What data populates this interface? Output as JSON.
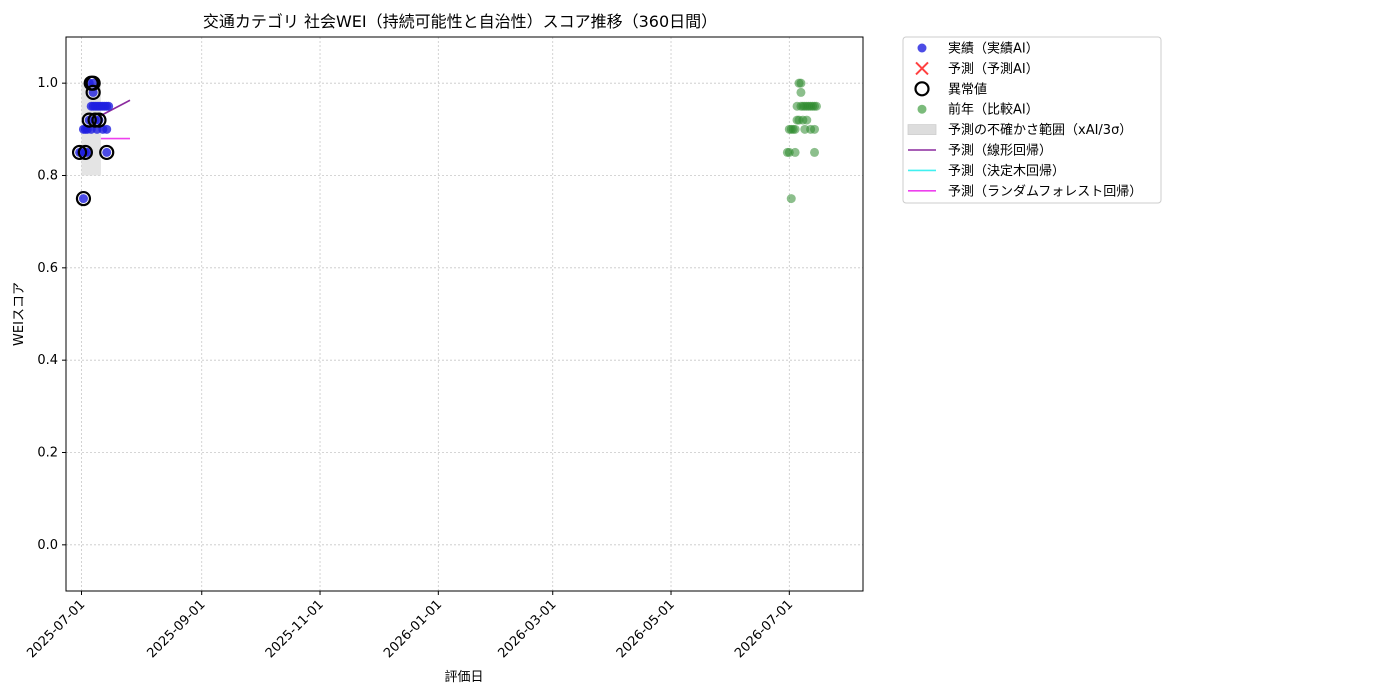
{
  "chart_data": {
    "type": "scatter",
    "title": "交通カテゴリ 社会WEI（持続可能性と自治性）スコア推移（360日間）",
    "xlabel": "評価日",
    "ylabel": "WEIスコア",
    "xlim": [
      "2025-06-23",
      "2026-08-08"
    ],
    "ylim": [
      -0.1,
      1.1
    ],
    "yticks": [
      0.0,
      0.2,
      0.4,
      0.6,
      0.8,
      1.0
    ],
    "ytick_labels": [
      "0.0",
      "0.2",
      "0.4",
      "0.6",
      "0.8",
      "1.0"
    ],
    "xticks": [
      "2025-07-01",
      "2025-09-01",
      "2025-11-01",
      "2026-01-01",
      "2026-03-01",
      "2026-05-01",
      "2026-07-01"
    ],
    "grid": true,
    "legend_position": "outside-right-top",
    "legend": [
      {
        "label": "実績（実績AI）",
        "kind": "dot",
        "color": "#1f1fe0"
      },
      {
        "label": "予測（予測AI）",
        "kind": "x",
        "color": "#ff4040"
      },
      {
        "label": "異常値",
        "kind": "ring",
        "color": "#000000"
      },
      {
        "label": "前年（比較AI）",
        "kind": "dot",
        "color": "#5aaa5a"
      },
      {
        "label": "予測の不確かさ範囲（xAI/3σ）",
        "kind": "band",
        "color": "#dddddd"
      },
      {
        "label": "予測（線形回帰）",
        "kind": "line",
        "color": "#8b2a9e"
      },
      {
        "label": "予測（決定木回帰）",
        "kind": "line",
        "color": "#40f0f0"
      },
      {
        "label": "予測（ランダムフォレスト回帰）",
        "kind": "line",
        "color": "#ee40ee"
      }
    ],
    "series": [
      {
        "name": "実績（実績AI）",
        "kind": "scatter",
        "color": "#1f1fe0",
        "points": [
          {
            "x": "2025-06-30",
            "y": 0.85
          },
          {
            "x": "2025-07-01",
            "y": 0.85
          },
          {
            "x": "2025-07-02",
            "y": 0.9
          },
          {
            "x": "2025-07-02",
            "y": 0.75
          },
          {
            "x": "2025-07-03",
            "y": 0.85
          },
          {
            "x": "2025-07-03",
            "y": 0.9
          },
          {
            "x": "2025-07-04",
            "y": 0.85
          },
          {
            "x": "2025-07-04",
            "y": 0.9
          },
          {
            "x": "2025-07-05",
            "y": 0.92
          },
          {
            "x": "2025-07-05",
            "y": 1.0
          },
          {
            "x": "2025-07-06",
            "y": 0.95
          },
          {
            "x": "2025-07-06",
            "y": 0.9
          },
          {
            "x": "2025-07-07",
            "y": 0.98
          },
          {
            "x": "2025-07-07",
            "y": 1.0
          },
          {
            "x": "2025-07-07",
            "y": 0.95
          },
          {
            "x": "2025-07-08",
            "y": 0.92
          },
          {
            "x": "2025-07-08",
            "y": 0.95
          },
          {
            "x": "2025-07-09",
            "y": 0.9
          },
          {
            "x": "2025-07-09",
            "y": 0.95
          },
          {
            "x": "2025-07-10",
            "y": 0.92
          },
          {
            "x": "2025-07-10",
            "y": 0.95
          },
          {
            "x": "2025-07-11",
            "y": 0.95
          },
          {
            "x": "2025-07-12",
            "y": 0.9
          },
          {
            "x": "2025-07-12",
            "y": 0.95
          },
          {
            "x": "2025-07-13",
            "y": 0.95
          },
          {
            "x": "2025-07-14",
            "y": 0.85
          },
          {
            "x": "2025-07-14",
            "y": 0.9
          },
          {
            "x": "2025-07-14",
            "y": 0.95
          },
          {
            "x": "2025-07-15",
            "y": 0.95
          }
        ]
      },
      {
        "name": "異常値",
        "kind": "rings",
        "color": "#000000",
        "points": [
          {
            "x": "2025-06-30",
            "y": 0.85
          },
          {
            "x": "2025-07-02",
            "y": 0.75
          },
          {
            "x": "2025-07-03",
            "y": 0.85
          },
          {
            "x": "2025-07-05",
            "y": 0.92
          },
          {
            "x": "2025-07-06",
            "y": 1.0
          },
          {
            "x": "2025-07-07",
            "y": 0.98
          },
          {
            "x": "2025-07-07",
            "y": 1.0
          },
          {
            "x": "2025-07-08",
            "y": 0.92
          },
          {
            "x": "2025-07-10",
            "y": 0.92
          },
          {
            "x": "2025-07-14",
            "y": 0.85
          }
        ]
      },
      {
        "name": "前年（比較AI）",
        "kind": "scatter",
        "color": "#2e8b2e",
        "points": [
          {
            "x": "2026-06-30",
            "y": 0.85
          },
          {
            "x": "2026-07-01",
            "y": 0.9
          },
          {
            "x": "2026-07-01",
            "y": 0.85
          },
          {
            "x": "2026-07-02",
            "y": 0.75
          },
          {
            "x": "2026-07-02",
            "y": 0.9
          },
          {
            "x": "2026-07-03",
            "y": 0.9
          },
          {
            "x": "2026-07-04",
            "y": 0.85
          },
          {
            "x": "2026-07-04",
            "y": 0.9
          },
          {
            "x": "2026-07-05",
            "y": 0.92
          },
          {
            "x": "2026-07-05",
            "y": 0.95
          },
          {
            "x": "2026-07-06",
            "y": 1.0
          },
          {
            "x": "2026-07-06",
            "y": 0.92
          },
          {
            "x": "2026-07-07",
            "y": 0.98
          },
          {
            "x": "2026-07-07",
            "y": 1.0
          },
          {
            "x": "2026-07-07",
            "y": 0.95
          },
          {
            "x": "2026-07-08",
            "y": 0.92
          },
          {
            "x": "2026-07-08",
            "y": 0.95
          },
          {
            "x": "2026-07-09",
            "y": 0.9
          },
          {
            "x": "2026-07-09",
            "y": 0.95
          },
          {
            "x": "2026-07-10",
            "y": 0.92
          },
          {
            "x": "2026-07-10",
            "y": 0.95
          },
          {
            "x": "2026-07-11",
            "y": 0.95
          },
          {
            "x": "2026-07-12",
            "y": 0.9
          },
          {
            "x": "2026-07-12",
            "y": 0.95
          },
          {
            "x": "2026-07-13",
            "y": 0.95
          },
          {
            "x": "2026-07-14",
            "y": 0.85
          },
          {
            "x": "2026-07-14",
            "y": 0.9
          },
          {
            "x": "2026-07-14",
            "y": 0.95
          },
          {
            "x": "2026-07-15",
            "y": 0.95
          }
        ]
      },
      {
        "name": "予測の不確かさ範囲（xAI/3σ）",
        "kind": "band",
        "color": "#d9d9d9",
        "x_range": [
          "2025-07-01",
          "2025-07-11"
        ],
        "y_range": [
          0.8,
          1.0
        ]
      },
      {
        "name": "予測（線形回帰）",
        "kind": "line",
        "color": "#8b2a9e",
        "points": [
          {
            "x": "2025-07-11",
            "y": 0.93
          },
          {
            "x": "2025-07-26",
            "y": 0.963
          }
        ]
      },
      {
        "name": "予測（ランダムフォレスト回帰）",
        "kind": "line",
        "color": "#ee40ee",
        "points": [
          {
            "x": "2025-07-11",
            "y": 0.88
          },
          {
            "x": "2025-07-26",
            "y": 0.88
          }
        ]
      }
    ]
  }
}
